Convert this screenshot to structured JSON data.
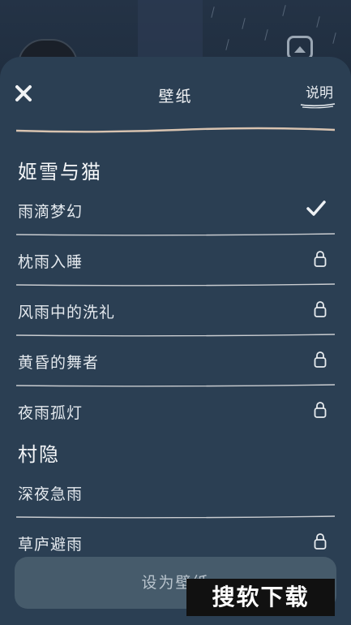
{
  "header": {
    "close_icon": "close-icon",
    "title": "壁纸",
    "help_label": "说明"
  },
  "sections": [
    {
      "title": "姬雪与猫",
      "items": [
        {
          "label": "雨滴梦幻",
          "icon": "check-icon"
        },
        {
          "label": "枕雨入睡",
          "icon": "lock-icon"
        },
        {
          "label": "风雨中的洗礼",
          "icon": "lock-icon"
        },
        {
          "label": "黄昏的舞者",
          "icon": "lock-icon"
        },
        {
          "label": "夜雨孤灯",
          "icon": "lock-icon"
        }
      ]
    },
    {
      "title": "村隐",
      "items": [
        {
          "label": "深夜急雨",
          "icon": ""
        },
        {
          "label": "草庐避雨",
          "icon": "lock-icon"
        }
      ]
    }
  ],
  "footer": {
    "set_wallpaper_label": "设为壁纸"
  },
  "watermark": "搜软下载",
  "colors": {
    "sheet": "#2b3f53",
    "button": "#465b6b",
    "divider": "#c9ccd0",
    "title_rule": "#d8c3b0"
  }
}
